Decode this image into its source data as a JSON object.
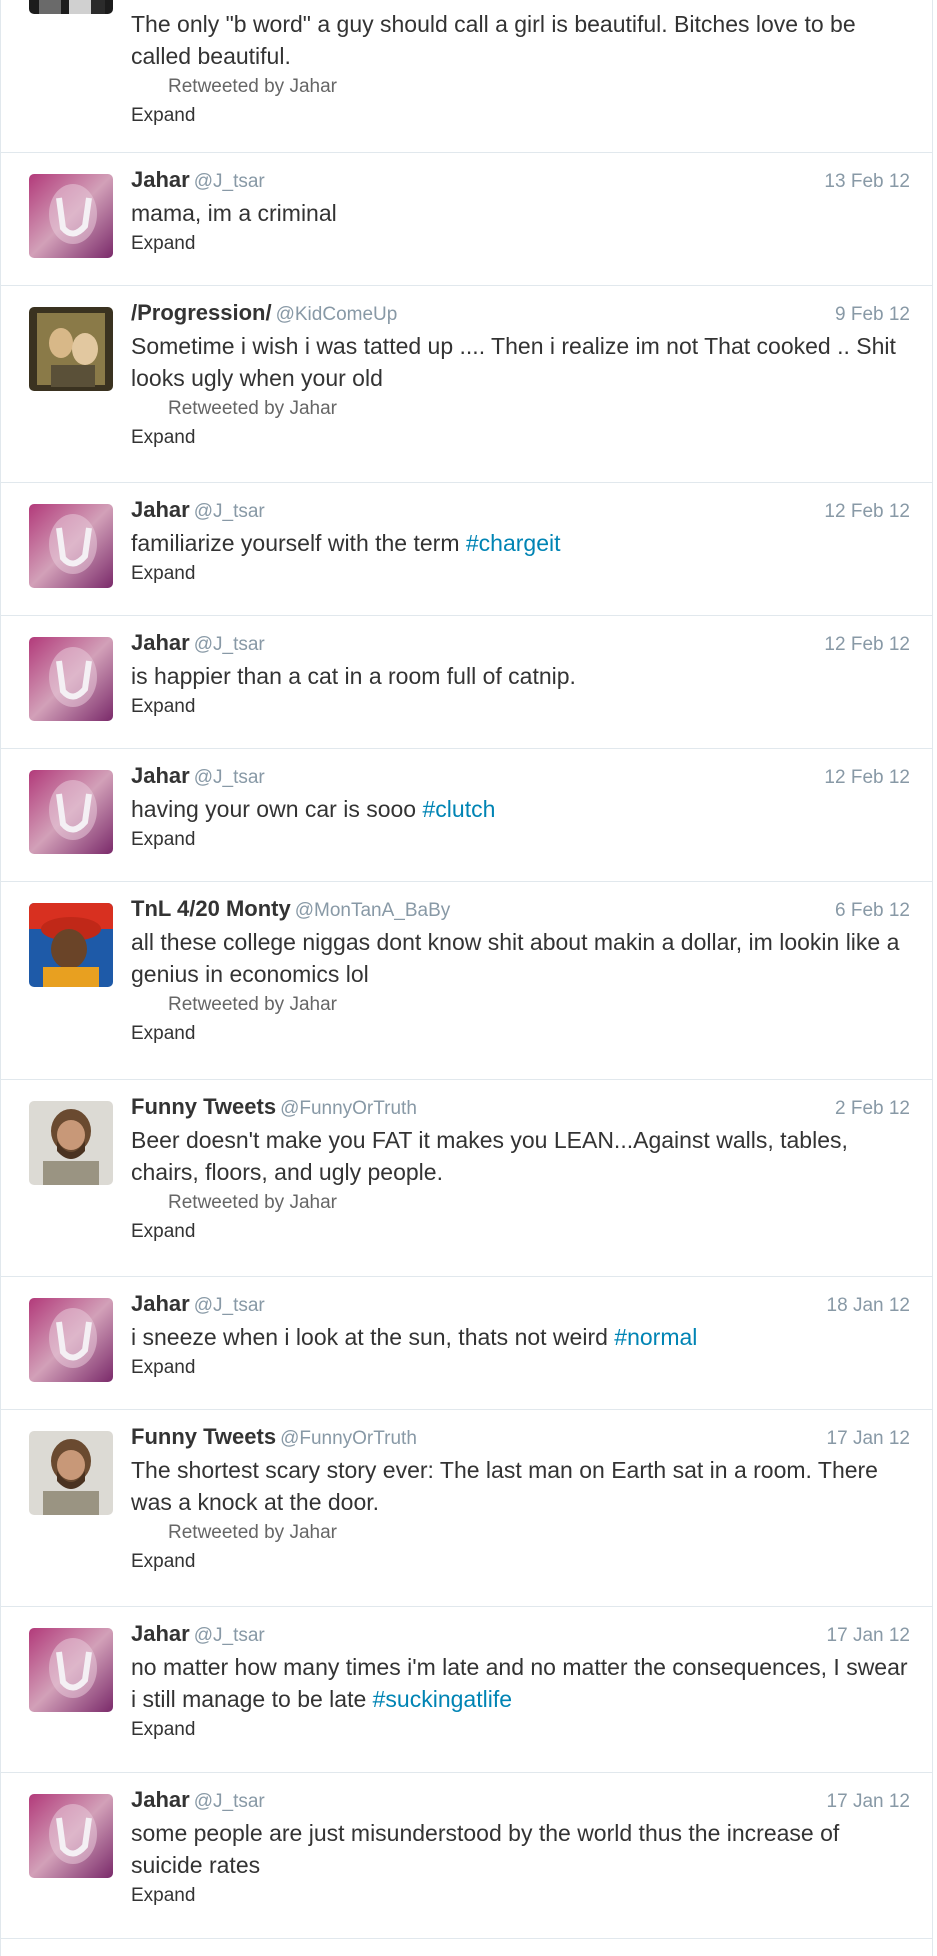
{
  "tweets": [
    {
      "name": "",
      "handle": "",
      "date": "",
      "avatar": "partial",
      "text": "The only \"b word\" a guy should call a girl is beautiful. Bitches love to be called beautiful.",
      "retweeted_by": "Retweeted by Jahar",
      "expand": "Expand"
    },
    {
      "name": "Jahar",
      "handle": "@J_tsar",
      "date": "13 Feb 12",
      "avatar": "jahar",
      "text": "mama, im a criminal",
      "retweeted_by": "",
      "expand": "Expand"
    },
    {
      "name": "/Progression/",
      "handle": "@KidComeUp",
      "date": "9 Feb 12",
      "avatar": "progression",
      "text": "Sometime i wish i was tatted up .... Then i realize im not That cooked .. Shit looks ugly when your old",
      "retweeted_by": "Retweeted by Jahar",
      "expand": "Expand"
    },
    {
      "name": "Jahar",
      "handle": "@J_tsar",
      "date": "12 Feb 12",
      "avatar": "jahar",
      "text_pre": "familiarize yourself with the term ",
      "hashtag": "#chargeit",
      "retweeted_by": "",
      "expand": "Expand"
    },
    {
      "name": "Jahar",
      "handle": "@J_tsar",
      "date": "12 Feb 12",
      "avatar": "jahar",
      "text": "is happier than a cat in a room full of catnip.",
      "retweeted_by": "",
      "expand": "Expand"
    },
    {
      "name": "Jahar",
      "handle": "@J_tsar",
      "date": "12 Feb 12",
      "avatar": "jahar",
      "text_pre": "having your own car is sooo ",
      "hashtag": "#clutch",
      "retweeted_by": "",
      "expand": "Expand"
    },
    {
      "name": "TnL 4/20 Monty",
      "handle": "@MonTanA_BaBy",
      "date": "6 Feb 12",
      "avatar": "monty",
      "text": "all these college niggas dont know shit about makin a dollar, im lookin like a genius in economics lol",
      "retweeted_by": "Retweeted by Jahar",
      "expand": "Expand"
    },
    {
      "name": "Funny Tweets",
      "handle": "@FunnyOrTruth",
      "date": "2 Feb 12",
      "avatar": "funny",
      "text": "Beer doesn't make you FAT it makes you LEAN...Against walls, tables, chairs, floors, and ugly people.",
      "retweeted_by": "Retweeted by Jahar",
      "expand": "Expand"
    },
    {
      "name": "Jahar",
      "handle": "@J_tsar",
      "date": "18 Jan 12",
      "avatar": "jahar",
      "text_pre": "i sneeze when i look at the sun, thats not weird ",
      "hashtag": "#normal",
      "retweeted_by": "",
      "expand": "Expand"
    },
    {
      "name": "Funny Tweets",
      "handle": "@FunnyOrTruth",
      "date": "17 Jan 12",
      "avatar": "funny",
      "text": "The shortest scary story ever: The last man on Earth sat in a room. There was a knock at the door.",
      "retweeted_by": "Retweeted by Jahar",
      "expand": "Expand"
    },
    {
      "name": "Jahar",
      "handle": "@J_tsar",
      "date": "17 Jan 12",
      "avatar": "jahar",
      "text_pre": "no matter how many times i'm late and no matter the consequences, I swear i still manage to be late ",
      "hashtag": "#suckingatlife",
      "retweeted_by": "",
      "expand": "Expand"
    },
    {
      "name": "Jahar",
      "handle": "@J_tsar",
      "date": "17 Jan 12",
      "avatar": "jahar",
      "text": "some people are just misunderstood by the world thus the increase of suicide rates",
      "retweeted_by": "",
      "expand": "Expand"
    }
  ]
}
